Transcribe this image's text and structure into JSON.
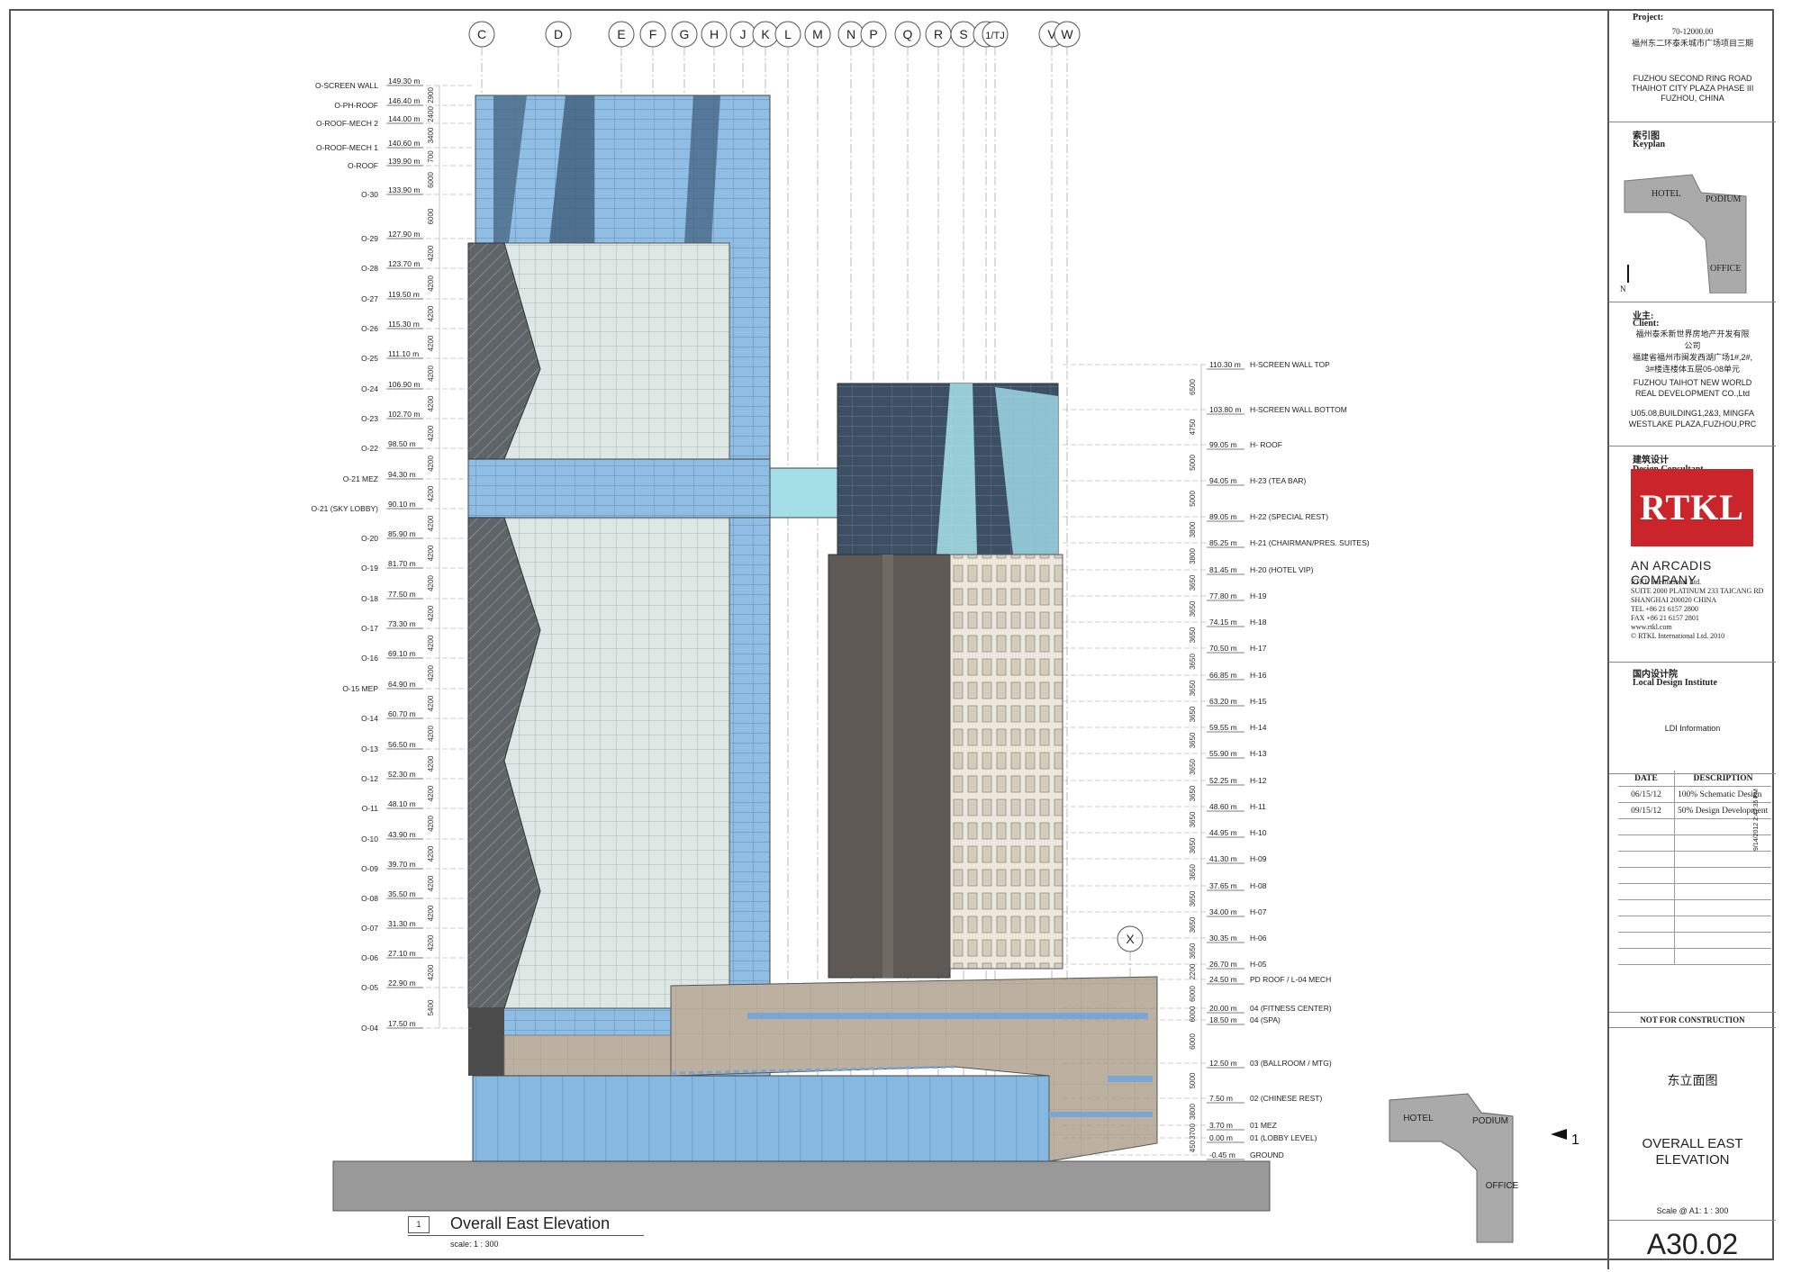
{
  "grid_labels": [
    "C",
    "D",
    "E",
    "F",
    "G",
    "H",
    "J",
    "K",
    "L",
    "M",
    "N",
    "P",
    "Q",
    "R",
    "S",
    "T",
    "1/TJ",
    "V",
    "W",
    "X"
  ],
  "office_levels": [
    {
      "name": "O-SCREEN WALL",
      "elev": "149.30 m",
      "dim": "2900"
    },
    {
      "name": "O-PH-ROOF",
      "elev": "146.40 m",
      "dim": "2400"
    },
    {
      "name": "O-ROOF-MECH 2",
      "elev": "144.00 m",
      "dim": "3400"
    },
    {
      "name": "O-ROOF-MECH 1",
      "elev": "140.60 m",
      "dim": "700"
    },
    {
      "name": "O-ROOF",
      "elev": "139.90 m",
      "dim": "6000"
    },
    {
      "name": "O-30",
      "elev": "133.90 m",
      "dim": "6000"
    },
    {
      "name": "O-29",
      "elev": "127.90 m",
      "dim": "4200"
    },
    {
      "name": "O-28",
      "elev": "123.70 m",
      "dim": "4200"
    },
    {
      "name": "O-27",
      "elev": "119.50 m",
      "dim": "4200"
    },
    {
      "name": "O-26",
      "elev": "115.30 m",
      "dim": "4200"
    },
    {
      "name": "O-25",
      "elev": "111.10 m",
      "dim": "4200"
    },
    {
      "name": "O-24",
      "elev": "106.90 m",
      "dim": "4200"
    },
    {
      "name": "O-23",
      "elev": "102.70 m",
      "dim": "4200"
    },
    {
      "name": "O-22",
      "elev": "98.50 m",
      "dim": "4200"
    },
    {
      "name": "O-21 MEZ",
      "elev": "94.30 m",
      "dim": "4200"
    },
    {
      "name": "O-21 (SKY LOBBY)",
      "elev": "90.10 m",
      "dim": "4200"
    },
    {
      "name": "O-20",
      "elev": "85.90 m",
      "dim": "4200"
    },
    {
      "name": "O-19",
      "elev": "81.70 m",
      "dim": "4200"
    },
    {
      "name": "O-18",
      "elev": "77.50 m",
      "dim": "4200"
    },
    {
      "name": "O-17",
      "elev": "73.30 m",
      "dim": "4200"
    },
    {
      "name": "O-16",
      "elev": "69.10 m",
      "dim": "4200"
    },
    {
      "name": "O-15 MEP",
      "elev": "64.90 m",
      "dim": "4200"
    },
    {
      "name": "O-14",
      "elev": "60.70 m",
      "dim": "4200"
    },
    {
      "name": "O-13",
      "elev": "56.50 m",
      "dim": "4200"
    },
    {
      "name": "O-12",
      "elev": "52.30 m",
      "dim": "4200"
    },
    {
      "name": "O-11",
      "elev": "48.10 m",
      "dim": "4200"
    },
    {
      "name": "O-10",
      "elev": "43.90 m",
      "dim": "4200"
    },
    {
      "name": "O-09",
      "elev": "39.70 m",
      "dim": "4200"
    },
    {
      "name": "O-08",
      "elev": "35.50 m",
      "dim": "4200"
    },
    {
      "name": "O-07",
      "elev": "31.30 m",
      "dim": "4200"
    },
    {
      "name": "O-06",
      "elev": "27.10 m",
      "dim": "4200"
    },
    {
      "name": "O-05",
      "elev": "22.90 m",
      "dim": "5400"
    },
    {
      "name": "O-04",
      "elev": "17.50 m",
      "dim": ""
    }
  ],
  "hotel_levels": [
    {
      "name": "H-SCREEN WALL TOP",
      "elev": "110.30 m",
      "dim": "6500"
    },
    {
      "name": "H-SCREEN WALL BOTTOM",
      "elev": "103.80 m",
      "dim": "4750"
    },
    {
      "name": "H- ROOF",
      "elev": "99.05 m",
      "dim": "5000"
    },
    {
      "name": "H-23 (TEA BAR)",
      "elev": "94.05 m",
      "dim": "5000"
    },
    {
      "name": "H-22 (SPECIAL REST)",
      "elev": "89.05 m",
      "dim": "3800"
    },
    {
      "name": "H-21 (CHAIRMAN/PRES. SUITES)",
      "elev": "85.25 m",
      "dim": "3800"
    },
    {
      "name": "H-20 (HOTEL VIP)",
      "elev": "81.45 m",
      "dim": "3650"
    },
    {
      "name": "H-19",
      "elev": "77.80 m",
      "dim": "3650"
    },
    {
      "name": "H-18",
      "elev": "74.15 m",
      "dim": "3650"
    },
    {
      "name": "H-17",
      "elev": "70.50 m",
      "dim": "3650"
    },
    {
      "name": "H-16",
      "elev": "66.85 m",
      "dim": "3650"
    },
    {
      "name": "H-15",
      "elev": "63.20 m",
      "dim": "3650"
    },
    {
      "name": "H-14",
      "elev": "59.55 m",
      "dim": "3650"
    },
    {
      "name": "H-13",
      "elev": "55.90 m",
      "dim": "3650"
    },
    {
      "name": "H-12",
      "elev": "52.25 m",
      "dim": "3650"
    },
    {
      "name": "H-11",
      "elev": "48.60 m",
      "dim": "3650"
    },
    {
      "name": "H-10",
      "elev": "44.95 m",
      "dim": "3650"
    },
    {
      "name": "H-09",
      "elev": "41.30 m",
      "dim": "3650"
    },
    {
      "name": "H-08",
      "elev": "37.65 m",
      "dim": "3650"
    },
    {
      "name": "H-07",
      "elev": "34.00 m",
      "dim": "3650"
    },
    {
      "name": "H-06",
      "elev": "30.35 m",
      "dim": "3650"
    },
    {
      "name": "H-05",
      "elev": "26.70 m",
      "dim": "2200"
    },
    {
      "name": "PD ROOF / L-04 MECH",
      "elev": "24.50 m",
      "dim": "6000"
    },
    {
      "name": "04 (FITNESS CENTER)",
      "elev": "20.00 m",
      "dim": "6000"
    },
    {
      "name": "04 (SPA)",
      "elev": "18.50 m",
      "dim": "6000"
    },
    {
      "name": "03 (BALLROOM / MTG)",
      "elev": "12.50 m",
      "dim": "5000"
    },
    {
      "name": "02 (CHINESE REST)",
      "elev": "7.50 m",
      "dim": "3800"
    },
    {
      "name": "01 MEZ",
      "elev": "3.70 m",
      "dim": "3700"
    },
    {
      "name": "01 (LOBBY LEVEL)",
      "elev": "0.00 m",
      "dim": "450"
    },
    {
      "name": "GROUND",
      "elev": "-0.45 m",
      "dim": ""
    }
  ],
  "drawing": {
    "caption_number": "1",
    "caption": "Overall East Elevation",
    "caption_scale": "scale:  1 : 300",
    "keyplan_labels": [
      "HOTEL",
      "PODIUM",
      "OFFICE"
    ],
    "view_marker": "1"
  },
  "title_block": {
    "project_label": "Project:",
    "project_number": "70-12000.00",
    "project_cn": "福州东二环泰禾城市广场项目三期",
    "project_en": [
      "FUZHOU SECOND RING ROAD",
      "THAIHOT CITY PLAZA PHASE III",
      "FUZHOU, CHINA"
    ],
    "keyplan_label": "索引图",
    "keyplan_label_en": "Keyplan",
    "keyplan_labels": [
      "HOTEL",
      "PODIUM",
      "OFFICE"
    ],
    "north": "N",
    "client_label": "业主:",
    "client_label_en": "Client:",
    "client_cn": [
      "福州泰禾新世界房地产开发有限",
      "公司",
      "福建省福州市闽发西湖广场1#,2#,",
      "3#楼连楼体五层05-08单元"
    ],
    "client_en": [
      "FUZHOU TAIHOT NEW WORLD",
      "REAL DEVELOPMENT CO.,Ltd",
      "",
      "U05.08,BUILDING1,2&3, MINGFA",
      "WESTLAKE PLAZA,FUZHOU,PRC"
    ],
    "consultant_label": "建筑设计",
    "consultant_label_en": "Design Consultant",
    "logo_text": "RTKL",
    "arcadis": "AN ARCADIS COMPANY",
    "address": [
      "RTKL International Ltd.",
      "SUITE 2000 PLATINUM  233 TAICANG RD",
      "SHANGHAI 200020 CHINA",
      "TEL      +86 21 6157 2800",
      "FAX      +86 21 6157 2801",
      "www.rtkl.com",
      "©  RTKL International Ltd. 2010"
    ],
    "ldi_label": "国内设计院",
    "ldi_label_en": "Local Design Institute",
    "ldi_info": "LDI Information",
    "rev_header": {
      "date": "DATE",
      "description": "DESCRIPTION"
    },
    "revisions": [
      {
        "date": "06/15/12",
        "description": "100% Schematic Design"
      },
      {
        "date": "09/15/12",
        "description": "50% Design Development"
      }
    ],
    "plot_stamp": "9/14/2012 2:47:35 PM",
    "not_for_construction": "NOT FOR CONSTRUCTION",
    "sheet_title_cn": "东立面图",
    "sheet_title_en": [
      "OVERALL EAST",
      "ELEVATION"
    ],
    "scale": "Scale @ A1:  1 : 300",
    "sheet_number": "A30.02"
  },
  "colors": {
    "glass": "#86b4dc",
    "glass_dark": "#4d7fa8",
    "slate": "#39495a",
    "stone": "#bdb0a0",
    "dark_panel": "#5b5651",
    "ground": "#9a9a9a",
    "brand_red": "#c9252b"
  }
}
